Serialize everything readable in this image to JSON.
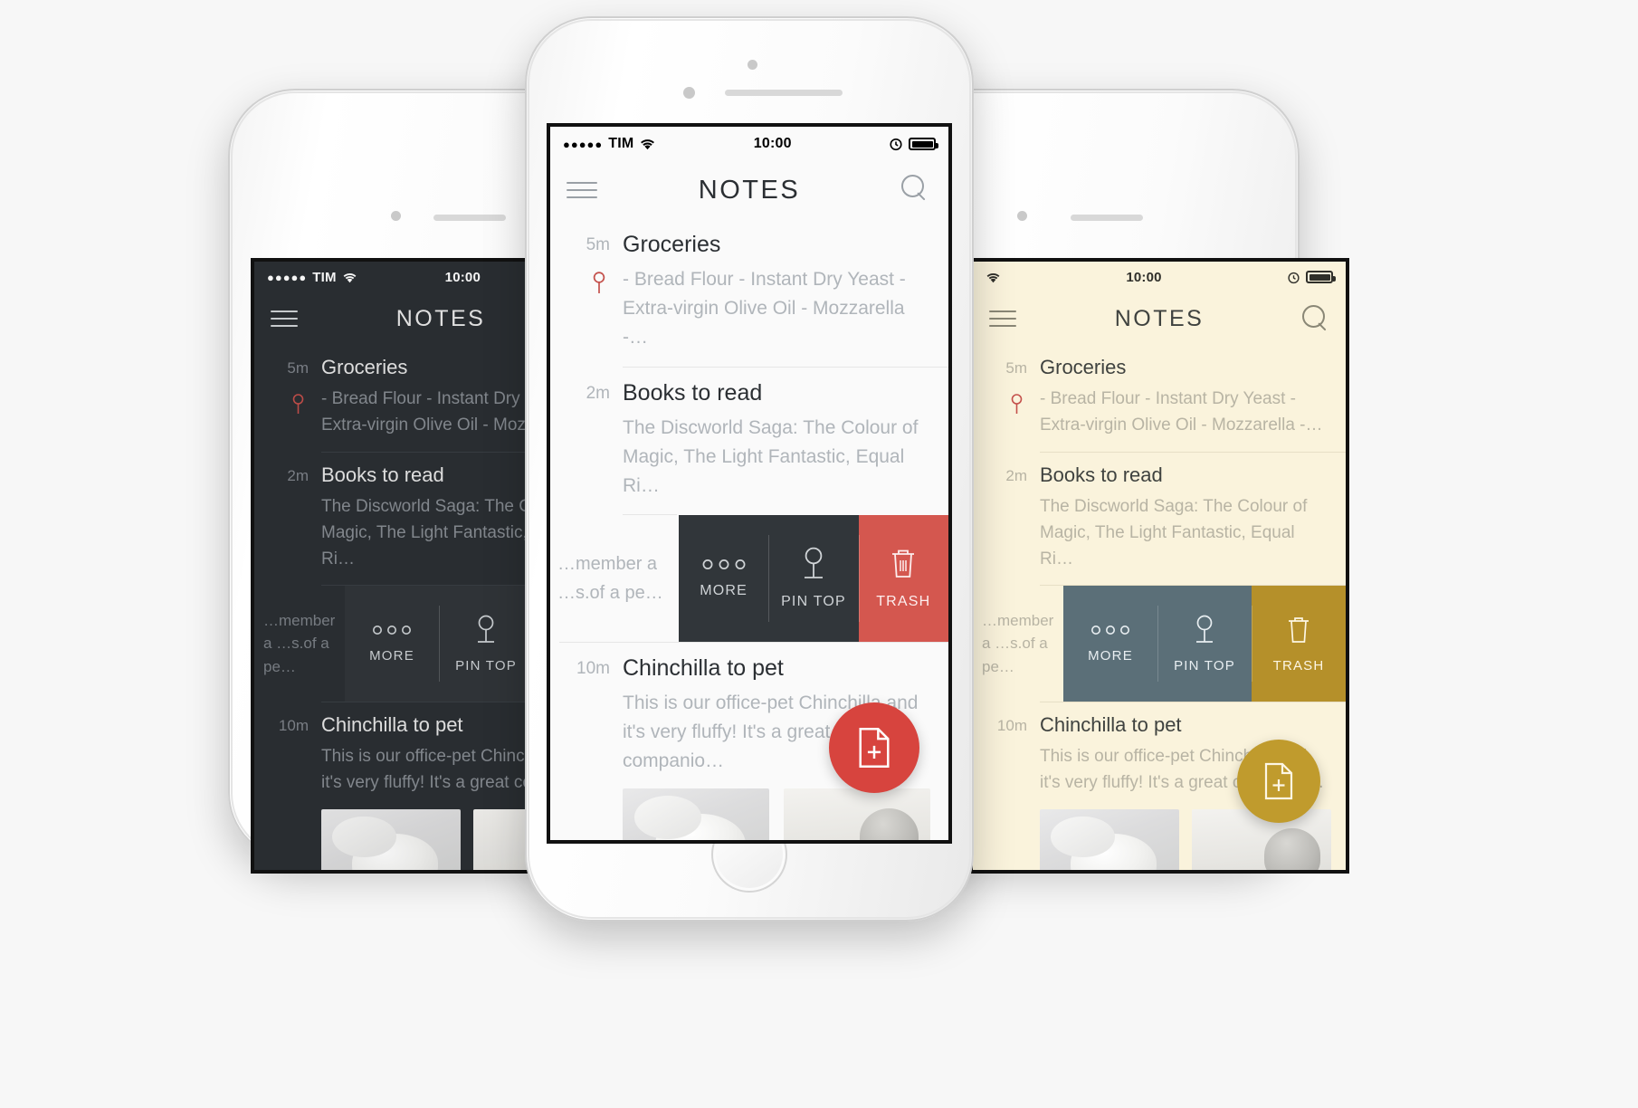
{
  "app": {
    "title": "NOTES",
    "menu_icon": "hamburger-menu-icon",
    "search_icon": "search-icon",
    "fab_icon": "new-note-icon"
  },
  "status_bar": {
    "carrier": "TIM",
    "signal_dots": "●●●●●",
    "wifi_icon": "wifi-icon",
    "time": "10:00",
    "alarm_icon": "alarm-clock-icon",
    "battery_icon": "battery-full-icon"
  },
  "notes": [
    {
      "time": "5m",
      "title": "Groceries",
      "snippet": "- Bread Flour - Instant Dry Yeast - Extra-virgin Olive Oil - Mozzarella -…",
      "pinned": true,
      "pin_icon": "pin-icon"
    },
    {
      "time": "2m",
      "title": "Books to read",
      "snippet": "The Discworld Saga: The Colour of Magic, The Light Fantastic, Equal Ri…",
      "pinned": false
    },
    {
      "time": "",
      "title": "",
      "snippet": "…member a …s.of a pe…",
      "pinned": false,
      "swiped": true
    },
    {
      "time": "10m",
      "title": "Chinchilla to pet",
      "snippet": "This is our office-pet Chinchilla and it's very fluffy! It's a great companio…",
      "pinned": false,
      "attachments": [
        "chinchilla-white-photo",
        "chinchilla-grey-photo"
      ]
    }
  ],
  "swipe_actions": [
    {
      "label": "MORE",
      "icon": "more-dots-icon"
    },
    {
      "label": "PIN TOP",
      "icon": "pin-icon"
    },
    {
      "label": "TRASH",
      "icon": "trash-can-icon"
    }
  ],
  "themes": {
    "dark": {
      "name": "dark-theme",
      "screen_bg": "#2b2f33",
      "text": "#e8e8e8",
      "muted": "#8a8f94",
      "title": "#e4e4e4",
      "divider": "#3d4247",
      "action_bg": "#2b2f33",
      "action_alt_bg": "#2b2f33",
      "trash_bg": "#9fbcc9",
      "fab_bg": "#c94f4a",
      "status_text": "#ffffff"
    },
    "light": {
      "name": "light-theme",
      "screen_bg": "#fafafa",
      "text": "#2f3336",
      "muted": "#b3b8bd",
      "title": "#2b2f33",
      "divider": "#e4e4e4",
      "action_bg": "#31363a",
      "action_alt_bg": "#31363a",
      "trash_bg": "#d4574f",
      "fab_bg": "#d7443e",
      "status_text": "#000000"
    },
    "cream": {
      "name": "cream-theme",
      "screen_bg": "#faf3dc",
      "text": "#4a4a42",
      "muted": "#b8b4a4",
      "title": "#3f423f",
      "divider": "#e7dfc6",
      "action_bg": "#5b6f78",
      "action_alt_bg": "#5b6f78",
      "trash_bg": "#b5902a",
      "fab_bg": "#c09b2d",
      "status_text": "#2f2f2a"
    }
  }
}
